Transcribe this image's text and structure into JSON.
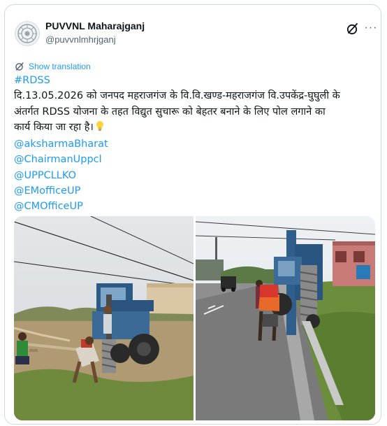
{
  "account": {
    "display_name": "PUVVNL Maharajganj",
    "handle": "@puvvnlmhrjganj"
  },
  "actions": {
    "grok_icon": "grok-icon",
    "more_icon": "more-dots-icon",
    "more_glyph": "···"
  },
  "translate": {
    "label": "Show translation",
    "icon": "translate-icon"
  },
  "post": {
    "hashtag": "#RDSS",
    "lines": [
      "दि.13.05.2026 को जनपद महराजगंज के वि.वि.खण्ड-महराजगंज वि.उपकेंद्र-घुघुली के",
      "अंतर्गत RDSS योजना के तहत विद्युत सुचारू को बेहतर बनाने के लिए पोल लगाने का",
      "कार्य किया जा रहा है।"
    ],
    "emoji_icon": "lightbulb-icon",
    "mentions": [
      "@aksharmaBharat",
      "@ChairmanUppcl",
      "@UPPCLLKO",
      "@EMofficeUP",
      "@CMOfficeUP"
    ]
  },
  "colors": {
    "link": "#1d9bf0",
    "text": "#0f1419",
    "muted": "#536471",
    "border": "#cfd9de",
    "machine_blue": "#2f5f8a"
  },
  "media": {
    "left_photo": "photo-field-pole-digging",
    "right_photo": "photo-roadside-auger-machine"
  }
}
